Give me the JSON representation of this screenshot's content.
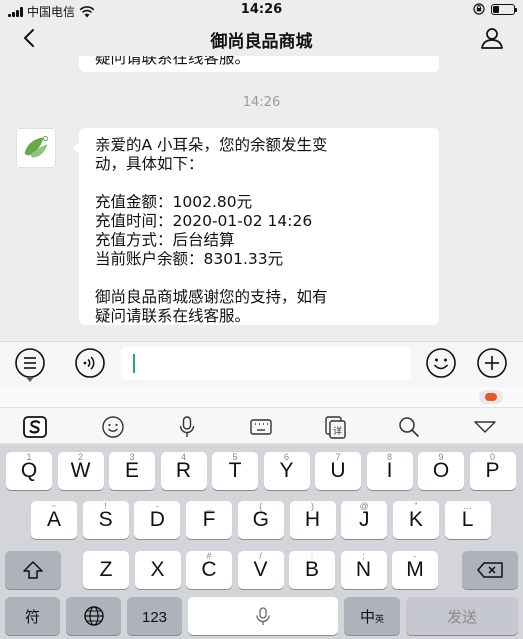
{
  "status_bar": {
    "carrier": "中国电信",
    "time": "14:26",
    "battery_level": 0.3
  },
  "nav": {
    "title": "御尚良品商城"
  },
  "chat": {
    "prev_message_tail": "疑问请联系在线客服。",
    "time_separator": "14:26",
    "message_lines": [
      "亲爱的A 小耳朵，您的余额发生变",
      "动，具体如下：",
      "",
      "充值金额：1002.80元",
      "充值时间：2020-01-02 14:26",
      "充值方式：后台结算",
      "当前账户余额：8301.33元",
      "",
      "御尚良品商城感谢您的支持，如有",
      "疑问请联系在线客服。"
    ]
  },
  "keyboard": {
    "row1": [
      {
        "k": "Q",
        "s": "1"
      },
      {
        "k": "W",
        "s": "2"
      },
      {
        "k": "E",
        "s": "3"
      },
      {
        "k": "R",
        "s": "4"
      },
      {
        "k": "T",
        "s": "5"
      },
      {
        "k": "Y",
        "s": "6"
      },
      {
        "k": "U",
        "s": "7"
      },
      {
        "k": "I",
        "s": "8"
      },
      {
        "k": "O",
        "s": "9"
      },
      {
        "k": "P",
        "s": "0"
      }
    ],
    "row2": [
      {
        "k": "A",
        "s": "~"
      },
      {
        "k": "S",
        "s": "!"
      },
      {
        "k": "D",
        "s": "-"
      },
      {
        "k": "F",
        "s": "_"
      },
      {
        "k": "G",
        "s": "("
      },
      {
        "k": "H",
        "s": ")"
      },
      {
        "k": "J",
        "s": "@"
      },
      {
        "k": "K",
        "s": "\""
      },
      {
        "k": "L",
        "s": "…"
      }
    ],
    "row3": [
      {
        "k": "Z",
        "s": ""
      },
      {
        "k": "X",
        "s": ""
      },
      {
        "k": "C",
        "s": "#"
      },
      {
        "k": "V",
        "s": "/"
      },
      {
        "k": "B",
        "s": ":"
      },
      {
        "k": "N",
        "s": ";"
      },
      {
        "k": "M",
        "s": "-"
      }
    ],
    "symbol_label": "符",
    "number_label": "123",
    "lang_label": "中",
    "lang_sub_label": "英",
    "send_label": "发送"
  }
}
